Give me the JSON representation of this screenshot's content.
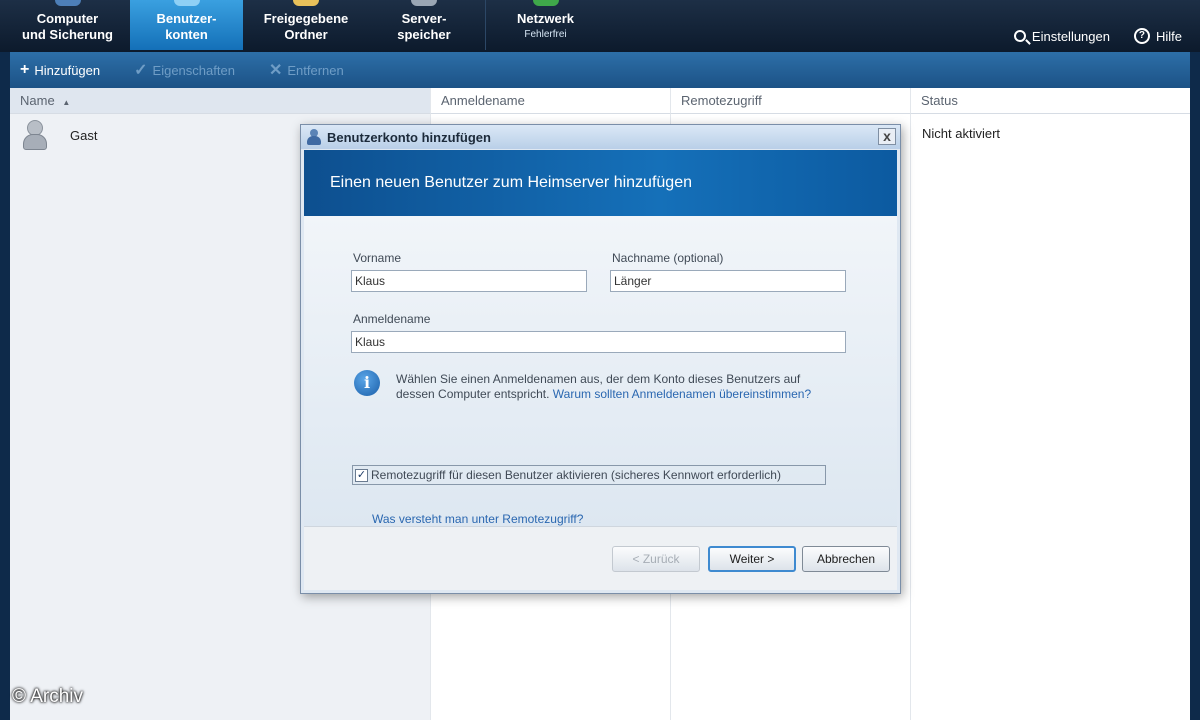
{
  "nav": {
    "tabs": [
      {
        "line1": "Computer",
        "line2": "und Sicherung",
        "sub": ""
      },
      {
        "line1": "Benutzer-",
        "line2": "konten",
        "sub": ""
      },
      {
        "line1": "Freigegebene",
        "line2": "Ordner",
        "sub": ""
      },
      {
        "line1": "Server-",
        "line2": "speicher",
        "sub": ""
      },
      {
        "line1": "Netzwerk",
        "line2": "",
        "sub": "Fehlerfrei"
      }
    ],
    "active_tab": "Benutzer-konten",
    "settings_label": "Einstellungen",
    "help_label": "Hilfe"
  },
  "toolbar": {
    "add_label": "Hinzufügen",
    "properties_label": "Eigenschaften",
    "remove_label": "Entfernen"
  },
  "table": {
    "columns": [
      "Name",
      "Anmeldename",
      "Remotezugriff",
      "Status"
    ],
    "sort_indicator": "▲",
    "rows": [
      {
        "name": "Gast",
        "login": "",
        "remote": "",
        "status": "Nicht aktiviert"
      }
    ]
  },
  "dialog": {
    "title": "Benutzerkonto hinzufügen",
    "close_glyph": "x",
    "banner": "Einen neuen Benutzer zum Heimserver hinzufügen",
    "first_name_label": "Vorname",
    "first_name_value": "Klaus",
    "last_name_label": "Nachname (optional)",
    "last_name_value": "Länger",
    "login_label": "Anmeldename",
    "login_value": "Klaus",
    "info_text": "Wählen Sie einen Anmeldenamen aus, der dem Konto dieses Benutzers auf dessen Computer entspricht.",
    "info_link": "Warum sollten Anmeldenamen übereinstimmen?",
    "remote_checkbox_label": "Remotezugriff für diesen Benutzer aktivieren (sicheres Kennwort erforderlich)",
    "remote_checked": true,
    "help_link": "Was versteht man unter Remotezugriff?",
    "back_button": "< Zurück",
    "next_button": "Weiter >",
    "cancel_button": "Abbrechen"
  },
  "watermark": "© Archiv",
  "colors": {
    "nav_bg": "#0c1a2c",
    "active_tab": "#1f84cc",
    "toolbar": "#245f97",
    "banner": "#1570b9",
    "link": "#2a67b0"
  }
}
